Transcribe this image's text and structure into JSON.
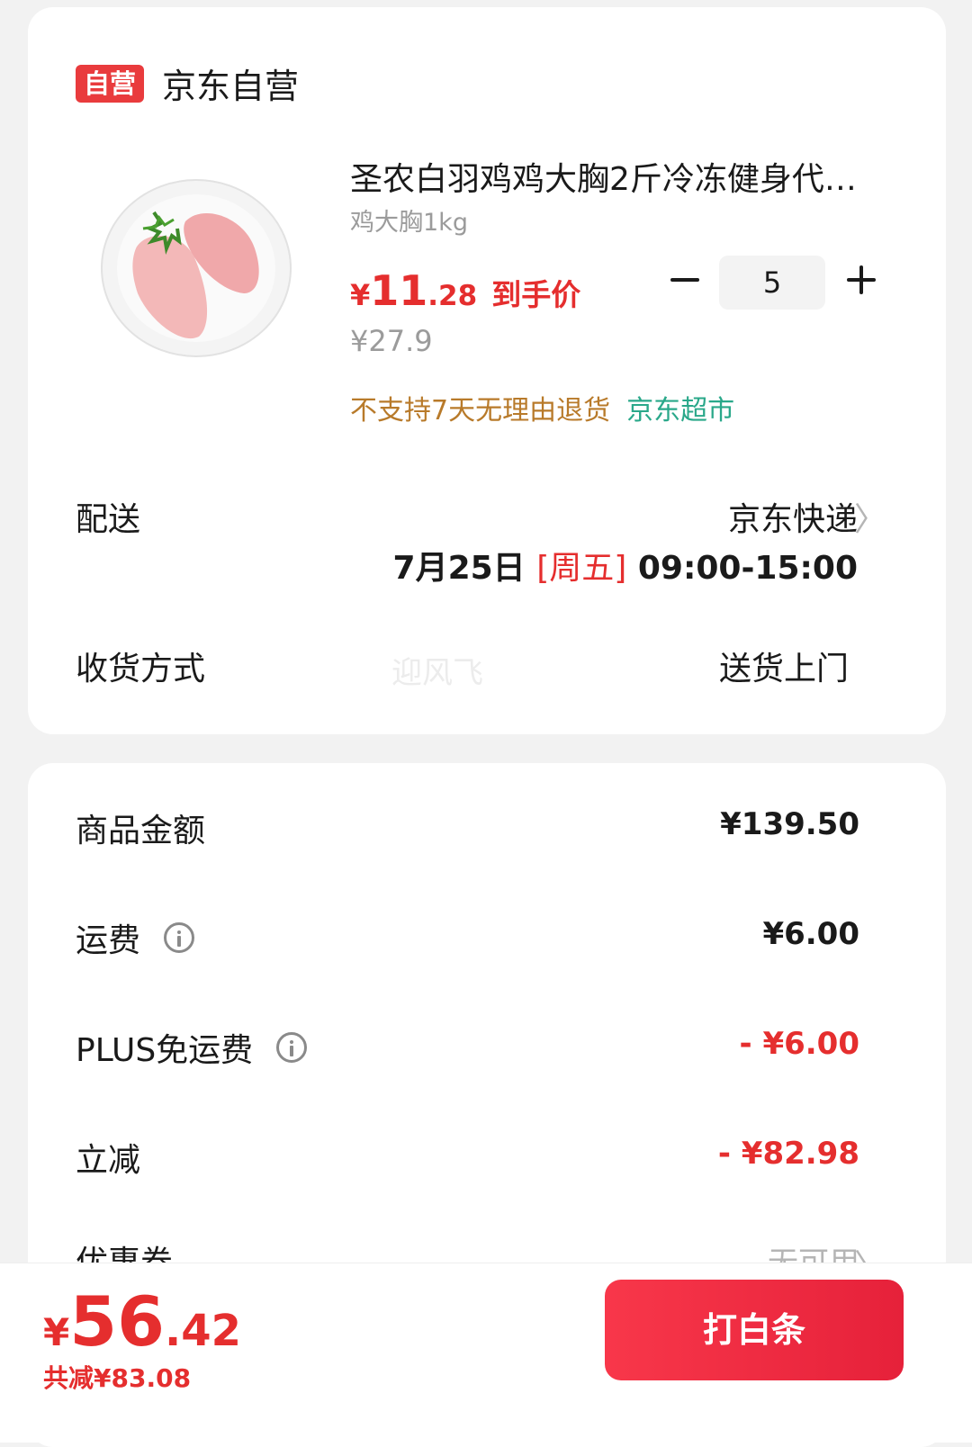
{
  "store": {
    "badge": "自营",
    "name": "京东自营"
  },
  "product": {
    "title": "圣农白羽鸡鸡大胸2斤冷冻健身代…",
    "spec": "鸡大胸1kg",
    "price_currency": "¥",
    "price_integer": "11",
    "price_decimal": ".28",
    "price_tag": "到手价",
    "original_price": "¥27.9",
    "quantity": "5",
    "tag_return": "不支持7天无理由退货",
    "tag_market": "京东超市"
  },
  "delivery": {
    "label": "配送",
    "carrier": "京东快递",
    "date": "7月25日",
    "weekday": "[周五]",
    "time_window": "09:00-15:00"
  },
  "receive": {
    "label": "收货方式",
    "watermark": "迎风飞",
    "value": "送货上门"
  },
  "summary": {
    "goods_amount_label": "商品金额",
    "goods_amount": "¥139.50",
    "shipping_label": "运费",
    "shipping": "¥6.00",
    "plus_label": "PLUS免运费",
    "plus_discount": "- ¥6.00",
    "instant_label": "立减",
    "instant_discount": "- ¥82.98",
    "coupon_label": "优惠券",
    "coupon_value": "无可用"
  },
  "bottom": {
    "total_currency": "¥",
    "total_integer": "56",
    "total_decimal": ".42",
    "saved": "共减¥83.08",
    "pay_button": "打白条"
  },
  "colors": {
    "accent": "#e52e2e",
    "badge": "#e93b3d",
    "return_tag": "#b87a2a",
    "market_tag": "#2aa88a",
    "background": "#f2f2f2"
  }
}
